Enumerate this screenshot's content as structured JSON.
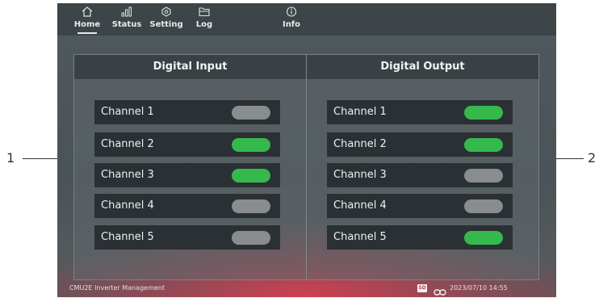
{
  "callouts": {
    "left": "1",
    "right": "2"
  },
  "nav": [
    {
      "label": "Home",
      "icon": "home-icon"
    },
    {
      "label": "Status",
      "icon": "bar-chart-icon"
    },
    {
      "label": "Setting",
      "icon": "gear-icon"
    },
    {
      "label": "Log",
      "icon": "folder-icon"
    },
    {
      "label": "Info",
      "icon": "info-icon"
    }
  ],
  "digital_input": {
    "title": "Digital Input",
    "channels": [
      {
        "label": "Channel 1",
        "on": false
      },
      {
        "label": "Channel 2",
        "on": true
      },
      {
        "label": "Channel 3",
        "on": true
      },
      {
        "label": "Channel 4",
        "on": false
      },
      {
        "label": "Channel 5",
        "on": false
      }
    ]
  },
  "digital_output": {
    "title": "Digital Output",
    "channels": [
      {
        "label": "Channel 1",
        "on": true
      },
      {
        "label": "Channel 2",
        "on": true
      },
      {
        "label": "Channel 3",
        "on": false
      },
      {
        "label": "Channel 4",
        "on": false
      },
      {
        "label": "Channel 5",
        "on": true
      }
    ]
  },
  "status": {
    "app_name": "CMU2E Inverter Management",
    "sd_label": "SD",
    "datetime": "2023/07/10 14:55"
  },
  "colors": {
    "toggle_on": "#35b94d",
    "toggle_off": "#8a8d8f"
  }
}
